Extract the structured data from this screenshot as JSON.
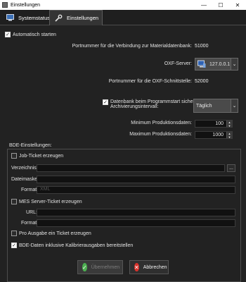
{
  "window": {
    "title": "Einstellungen"
  },
  "tabs": [
    {
      "label": "Systemstatus",
      "icon": "computer-icon"
    },
    {
      "label": "Einstellungen",
      "icon": "wrench-icon"
    }
  ],
  "settings": {
    "autostart_label": "Automatisch starten",
    "port_material_label": "Portnummer für die Verbindung zur Materialdatenbank:",
    "port_material_value": "51000",
    "oxf_server_label": "OXF-Server:",
    "oxf_server_value": "127.0.0.1",
    "port_oxf_label": "Portnummer für die OXF-Schnittstelle:",
    "port_oxf_value": "52000",
    "backup_label_line1": "Datenbank beim Programmstart sichern.",
    "backup_label_line2": "Archivierungsintervall:",
    "interval_value": "Täglich",
    "min_prod_label": "Minimum Produktionsdaten:",
    "min_prod_value": "100",
    "max_prod_label": "Maximum Produktionsdaten:",
    "max_prod_value": "1000"
  },
  "bde": {
    "title": "BDE-Einstellungen:",
    "job_ticket_label": "Job-Ticket erzeugen",
    "directory_label": "Verzeichnis:",
    "browse_label": "...",
    "filemask_label": "Dateimaske:",
    "format_label": "Format:",
    "format_value": "XML",
    "mes_label": "MES Server-Ticket erzeugen",
    "url_label": "URL:",
    "format2_label": "Format:",
    "per_output_label": "Pro Ausgabe ein Ticket erzeugen",
    "calib_label": "BDE-Daten inklusive Kalibrierausgaben bereitstellen"
  },
  "buttons": {
    "apply": "Übernehmen",
    "cancel": "Abbrechen"
  },
  "colors": {
    "accent_green": "#4caf50",
    "cancel_red": "#d9322b"
  }
}
